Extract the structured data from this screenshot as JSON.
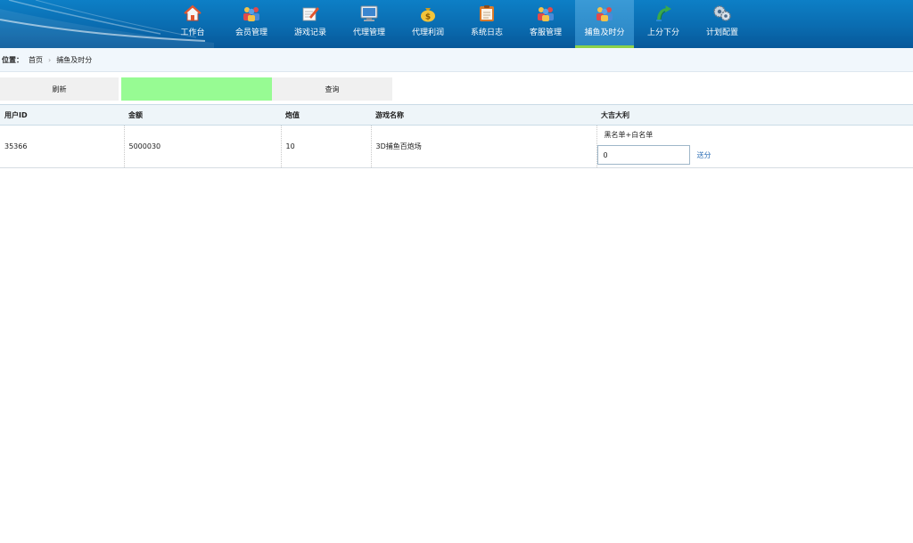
{
  "nav": {
    "items": [
      {
        "label": "工作台",
        "icon": "home-icon"
      },
      {
        "label": "会员管理",
        "icon": "members-icon"
      },
      {
        "label": "游戏记录",
        "icon": "game-record-icon"
      },
      {
        "label": "代理管理",
        "icon": "monitor-icon"
      },
      {
        "label": "代理利润",
        "icon": "money-bag-icon"
      },
      {
        "label": "系统日志",
        "icon": "clipboard-icon"
      },
      {
        "label": "客服管理",
        "icon": "service-icon"
      },
      {
        "label": "捕鱼及时分",
        "icon": "fishing-icon",
        "active": true
      },
      {
        "label": "上分下分",
        "icon": "transfer-icon"
      },
      {
        "label": "计划配置",
        "icon": "gears-icon"
      }
    ]
  },
  "breadcrumb": {
    "prefix": "位置：",
    "home": "首页",
    "separator": "›",
    "current": "捕鱼及时分"
  },
  "toolbar": {
    "refresh_label": "刷新",
    "query_label": "查询",
    "input_value": ""
  },
  "table": {
    "headers": [
      "用户ID",
      "金额",
      "炮值",
      "游戏名称",
      "大吉大利"
    ],
    "rows": [
      {
        "user_id": "35366",
        "amount": "5000030",
        "cannon": "10",
        "game_name": "3D捕鱼百炮场",
        "bonus_type": "黑名单+白名单",
        "bonus_value": "0",
        "send_label": "送分"
      }
    ]
  },
  "colors": {
    "header_bg": "#0a6cb0",
    "active_underline": "#8bd14a",
    "input_green": "#97fb93",
    "link_blue": "#2a6cb5"
  }
}
